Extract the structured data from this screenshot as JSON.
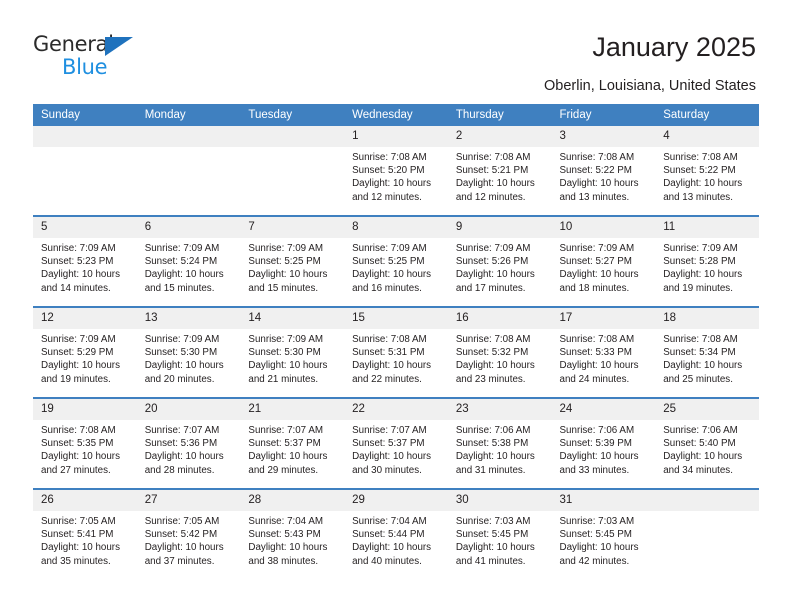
{
  "brand": {
    "name_top": "General",
    "name_bottom": "Blue",
    "accent_color": "#1f72bd",
    "blue_text_color": "#1f8fe0"
  },
  "header": {
    "title": "January 2025",
    "subtitle": "Oberlin, Louisiana, United States"
  },
  "calendar": {
    "header_bg": "#3f80c0",
    "header_text_color": "#ffffff",
    "daynum_bg": "#f0f0f0",
    "weekday_headers": [
      "Sunday",
      "Monday",
      "Tuesday",
      "Wednesday",
      "Thursday",
      "Friday",
      "Saturday"
    ],
    "weeks": [
      [
        {
          "day": "",
          "empty": true,
          "sunrise": "",
          "sunset": "",
          "daylight": ""
        },
        {
          "day": "",
          "empty": true,
          "sunrise": "",
          "sunset": "",
          "daylight": ""
        },
        {
          "day": "",
          "empty": true,
          "sunrise": "",
          "sunset": "",
          "daylight": ""
        },
        {
          "day": "1",
          "empty": false,
          "sunrise": "Sunrise: 7:08 AM",
          "sunset": "Sunset: 5:20 PM",
          "daylight": "Daylight: 10 hours and 12 minutes."
        },
        {
          "day": "2",
          "empty": false,
          "sunrise": "Sunrise: 7:08 AM",
          "sunset": "Sunset: 5:21 PM",
          "daylight": "Daylight: 10 hours and 12 minutes."
        },
        {
          "day": "3",
          "empty": false,
          "sunrise": "Sunrise: 7:08 AM",
          "sunset": "Sunset: 5:22 PM",
          "daylight": "Daylight: 10 hours and 13 minutes."
        },
        {
          "day": "4",
          "empty": false,
          "sunrise": "Sunrise: 7:08 AM",
          "sunset": "Sunset: 5:22 PM",
          "daylight": "Daylight: 10 hours and 13 minutes."
        }
      ],
      [
        {
          "day": "5",
          "empty": false,
          "sunrise": "Sunrise: 7:09 AM",
          "sunset": "Sunset: 5:23 PM",
          "daylight": "Daylight: 10 hours and 14 minutes."
        },
        {
          "day": "6",
          "empty": false,
          "sunrise": "Sunrise: 7:09 AM",
          "sunset": "Sunset: 5:24 PM",
          "daylight": "Daylight: 10 hours and 15 minutes."
        },
        {
          "day": "7",
          "empty": false,
          "sunrise": "Sunrise: 7:09 AM",
          "sunset": "Sunset: 5:25 PM",
          "daylight": "Daylight: 10 hours and 15 minutes."
        },
        {
          "day": "8",
          "empty": false,
          "sunrise": "Sunrise: 7:09 AM",
          "sunset": "Sunset: 5:25 PM",
          "daylight": "Daylight: 10 hours and 16 minutes."
        },
        {
          "day": "9",
          "empty": false,
          "sunrise": "Sunrise: 7:09 AM",
          "sunset": "Sunset: 5:26 PM",
          "daylight": "Daylight: 10 hours and 17 minutes."
        },
        {
          "day": "10",
          "empty": false,
          "sunrise": "Sunrise: 7:09 AM",
          "sunset": "Sunset: 5:27 PM",
          "daylight": "Daylight: 10 hours and 18 minutes."
        },
        {
          "day": "11",
          "empty": false,
          "sunrise": "Sunrise: 7:09 AM",
          "sunset": "Sunset: 5:28 PM",
          "daylight": "Daylight: 10 hours and 19 minutes."
        }
      ],
      [
        {
          "day": "12",
          "empty": false,
          "sunrise": "Sunrise: 7:09 AM",
          "sunset": "Sunset: 5:29 PM",
          "daylight": "Daylight: 10 hours and 19 minutes."
        },
        {
          "day": "13",
          "empty": false,
          "sunrise": "Sunrise: 7:09 AM",
          "sunset": "Sunset: 5:30 PM",
          "daylight": "Daylight: 10 hours and 20 minutes."
        },
        {
          "day": "14",
          "empty": false,
          "sunrise": "Sunrise: 7:09 AM",
          "sunset": "Sunset: 5:30 PM",
          "daylight": "Daylight: 10 hours and 21 minutes."
        },
        {
          "day": "15",
          "empty": false,
          "sunrise": "Sunrise: 7:08 AM",
          "sunset": "Sunset: 5:31 PM",
          "daylight": "Daylight: 10 hours and 22 minutes."
        },
        {
          "day": "16",
          "empty": false,
          "sunrise": "Sunrise: 7:08 AM",
          "sunset": "Sunset: 5:32 PM",
          "daylight": "Daylight: 10 hours and 23 minutes."
        },
        {
          "day": "17",
          "empty": false,
          "sunrise": "Sunrise: 7:08 AM",
          "sunset": "Sunset: 5:33 PM",
          "daylight": "Daylight: 10 hours and 24 minutes."
        },
        {
          "day": "18",
          "empty": false,
          "sunrise": "Sunrise: 7:08 AM",
          "sunset": "Sunset: 5:34 PM",
          "daylight": "Daylight: 10 hours and 25 minutes."
        }
      ],
      [
        {
          "day": "19",
          "empty": false,
          "sunrise": "Sunrise: 7:08 AM",
          "sunset": "Sunset: 5:35 PM",
          "daylight": "Daylight: 10 hours and 27 minutes."
        },
        {
          "day": "20",
          "empty": false,
          "sunrise": "Sunrise: 7:07 AM",
          "sunset": "Sunset: 5:36 PM",
          "daylight": "Daylight: 10 hours and 28 minutes."
        },
        {
          "day": "21",
          "empty": false,
          "sunrise": "Sunrise: 7:07 AM",
          "sunset": "Sunset: 5:37 PM",
          "daylight": "Daylight: 10 hours and 29 minutes."
        },
        {
          "day": "22",
          "empty": false,
          "sunrise": "Sunrise: 7:07 AM",
          "sunset": "Sunset: 5:37 PM",
          "daylight": "Daylight: 10 hours and 30 minutes."
        },
        {
          "day": "23",
          "empty": false,
          "sunrise": "Sunrise: 7:06 AM",
          "sunset": "Sunset: 5:38 PM",
          "daylight": "Daylight: 10 hours and 31 minutes."
        },
        {
          "day": "24",
          "empty": false,
          "sunrise": "Sunrise: 7:06 AM",
          "sunset": "Sunset: 5:39 PM",
          "daylight": "Daylight: 10 hours and 33 minutes."
        },
        {
          "day": "25",
          "empty": false,
          "sunrise": "Sunrise: 7:06 AM",
          "sunset": "Sunset: 5:40 PM",
          "daylight": "Daylight: 10 hours and 34 minutes."
        }
      ],
      [
        {
          "day": "26",
          "empty": false,
          "sunrise": "Sunrise: 7:05 AM",
          "sunset": "Sunset: 5:41 PM",
          "daylight": "Daylight: 10 hours and 35 minutes."
        },
        {
          "day": "27",
          "empty": false,
          "sunrise": "Sunrise: 7:05 AM",
          "sunset": "Sunset: 5:42 PM",
          "daylight": "Daylight: 10 hours and 37 minutes."
        },
        {
          "day": "28",
          "empty": false,
          "sunrise": "Sunrise: 7:04 AM",
          "sunset": "Sunset: 5:43 PM",
          "daylight": "Daylight: 10 hours and 38 minutes."
        },
        {
          "day": "29",
          "empty": false,
          "sunrise": "Sunrise: 7:04 AM",
          "sunset": "Sunset: 5:44 PM",
          "daylight": "Daylight: 10 hours and 40 minutes."
        },
        {
          "day": "30",
          "empty": false,
          "sunrise": "Sunrise: 7:03 AM",
          "sunset": "Sunset: 5:45 PM",
          "daylight": "Daylight: 10 hours and 41 minutes."
        },
        {
          "day": "31",
          "empty": false,
          "sunrise": "Sunrise: 7:03 AM",
          "sunset": "Sunset: 5:45 PM",
          "daylight": "Daylight: 10 hours and 42 minutes."
        },
        {
          "day": "",
          "empty": true,
          "sunrise": "",
          "sunset": "",
          "daylight": ""
        }
      ]
    ]
  }
}
